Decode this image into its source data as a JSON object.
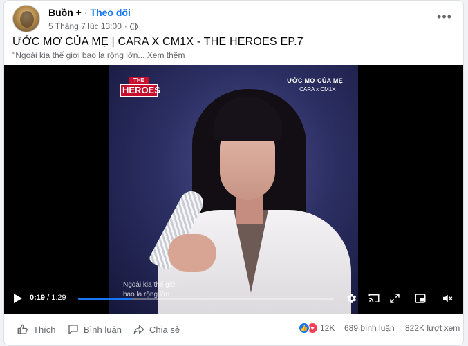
{
  "post": {
    "author": "Buồn +",
    "separator": "·",
    "follow_label": "Theo dõi",
    "timestamp": "5 Tháng 7 lúc 13:00",
    "meta_separator": "·",
    "more_label": "•••",
    "title": "ƯỚC MƠ CỦA MẸ | CARA X CM1X - THE HEROES EP.7",
    "caption_text": "\"Ngoài kia thế giới bao la rộng lớn...",
    "see_more": "Xem thêm"
  },
  "video": {
    "logo_the": "THE",
    "logo_heroes": "HEROES",
    "overlay_title": "ƯỚC MƠ CỦA MẸ",
    "overlay_subtitle": "CARA x CM1X",
    "subtitle_line1": "Ngoài kia thế giới",
    "subtitle_line2": "bao la rộng lớn",
    "current_time": "0:19",
    "time_separator": " / ",
    "duration": "1:29",
    "progress_fraction": 0.21,
    "icons": [
      "play-icon",
      "settings-icon",
      "cast-icon",
      "fullscreen-icon",
      "picture-in-picture-icon",
      "mute-icon"
    ]
  },
  "actions": {
    "like": "Thích",
    "comment": "Bình luận",
    "share": "Chia sẻ"
  },
  "stats": {
    "reactions_count": "12K",
    "comments": "689 bình luận",
    "views": "822K lượt xem"
  },
  "colors": {
    "accent": "#1877f2",
    "love": "#f33e58",
    "secondary_text": "#65676b"
  }
}
